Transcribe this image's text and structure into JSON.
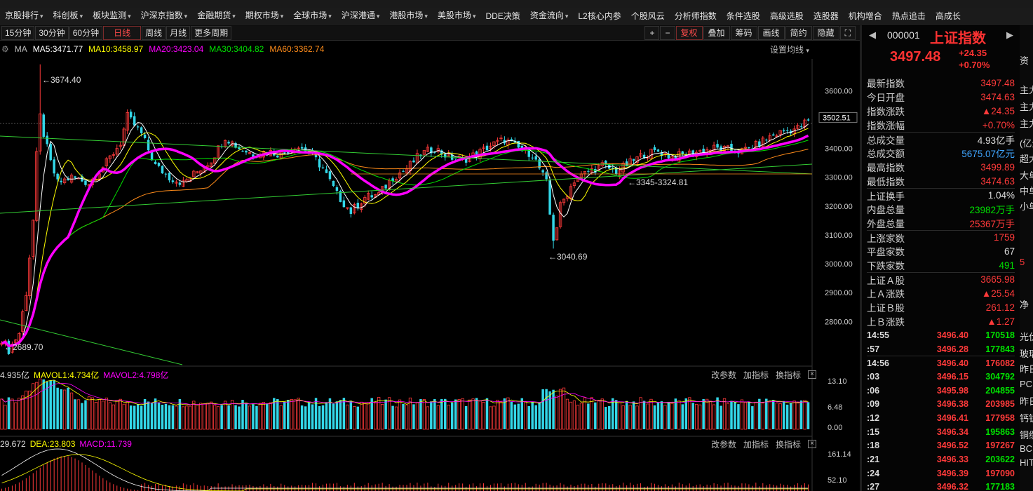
{
  "nav": {
    "items": [
      "京股排行",
      "科创板",
      "板块监测",
      "沪深京指数",
      "金融期货",
      "期权市场",
      "全球市场",
      "沪深港通",
      "港股市场",
      "美股市场",
      "DDE决策",
      "资金流向",
      "L2核心内参",
      "个股风云",
      "分析师指数",
      "条件选股",
      "高级选股",
      "选股器",
      "机构增合",
      "热点追击",
      "高成长"
    ]
  },
  "toolbar": {
    "periods": [
      "15分钟",
      "30分钟",
      "60分钟",
      "日线",
      "周线",
      "月线",
      "更多周期"
    ],
    "active_period": "日线",
    "right_buttons": [
      "复权",
      "叠加",
      "筹码",
      "画线",
      "简约",
      "隐藏"
    ]
  },
  "ma_legend": {
    "label": "MA",
    "ma5": "MA5:3471.77",
    "ma10": "MA10:3458.97",
    "ma20": "MA20:3423.04",
    "ma30": "MA30:3404.82",
    "ma60": "MA60:3362.74",
    "setting": "设置均线"
  },
  "colors": {
    "up": "#ff3a3a",
    "down": "#33d7e8",
    "ma5": "#ffffff",
    "ma10": "#ffff00",
    "ma20": "#ff00ff",
    "ma30": "#00e000",
    "ma60": "#ff8c1a"
  },
  "price_axis": {
    "ticks": [
      "3600.00",
      "3500.00",
      "3400.00",
      "3300.00",
      "3200.00",
      "3100.00",
      "3000.00",
      "2900.00",
      "2800.00"
    ],
    "current": "3502.51"
  },
  "annotations": {
    "high": "3674.40",
    "low_recent": "3040.69",
    "low_start": "2689.70",
    "mid": "3345-3324.81"
  },
  "volume_legend": {
    "vol": "4.935亿",
    "mavol1": "MAVOL1:4.734亿",
    "mavol2": "MAVOL2:4.798亿",
    "axis": [
      "13.10",
      "6.48",
      "0.00"
    ]
  },
  "macd_legend": {
    "dif": "29.672",
    "dea": "DEA:23.803",
    "macd": "MACD:11.739",
    "axis": [
      "161.14",
      "52.10"
    ]
  },
  "sub_tools": [
    "改参数",
    "加指标",
    "换指标"
  ],
  "quote": {
    "code": "000001",
    "name": "上证指数",
    "price": "3497.48",
    "change": "+24.35",
    "pct": "+0.70%",
    "stats": [
      {
        "label": "最新指数",
        "value": "3497.48",
        "cls": ""
      },
      {
        "label": "今日开盘",
        "value": "3474.63",
        "cls": ""
      },
      {
        "label": "指数涨跌",
        "value": "▲24.35",
        "cls": ""
      },
      {
        "label": "指数涨幅",
        "value": "+0.70%",
        "cls": ""
      },
      {
        "label": "总成交量",
        "value": "4.93亿手",
        "cls": "w"
      },
      {
        "label": "总成交额",
        "value": "5675.07亿元",
        "cls": "b"
      },
      {
        "label": "最高指数",
        "value": "3499.89",
        "cls": ""
      },
      {
        "label": "最低指数",
        "value": "3474.63",
        "cls": ""
      },
      {
        "label": "上证换手",
        "value": "1.04%",
        "cls": "w"
      },
      {
        "label": "内盘总量",
        "value": "23982万手",
        "cls": "g"
      },
      {
        "label": "外盘总量",
        "value": "25367万手",
        "cls": ""
      },
      {
        "label": "上涨家数",
        "value": "1759",
        "cls": ""
      },
      {
        "label": "平盘家数",
        "value": "67",
        "cls": "w"
      },
      {
        "label": "下跌家数",
        "value": "491",
        "cls": "g"
      },
      {
        "label": "上证Ａ股",
        "value": "3665.98",
        "cls": ""
      },
      {
        "label": "上Ａ涨跌",
        "value": "▲25.54",
        "cls": ""
      },
      {
        "label": "上证Ｂ股",
        "value": "261.12",
        "cls": ""
      },
      {
        "label": "上Ｂ涨跌",
        "value": "▲1.27",
        "cls": ""
      }
    ],
    "ticks": [
      {
        "t": "14:55",
        "p": "3496.40",
        "v": "170518",
        "c": "g"
      },
      {
        "t": ":57",
        "p": "3496.28",
        "v": "177843",
        "c": "g"
      },
      {
        "t": "14:56",
        "p": "3496.40",
        "v": "176082",
        "c": "r"
      },
      {
        "t": ":03",
        "p": "3496.15",
        "v": "304792",
        "c": "g"
      },
      {
        "t": ":06",
        "p": "3495.98",
        "v": "204855",
        "c": "g"
      },
      {
        "t": ":09",
        "p": "3496.38",
        "v": "203985",
        "c": "r"
      },
      {
        "t": ":12",
        "p": "3496.41",
        "v": "177958",
        "c": "r"
      },
      {
        "t": ":15",
        "p": "3496.34",
        "v": "195863",
        "c": "g"
      },
      {
        "t": ":18",
        "p": "3496.52",
        "v": "197267",
        "c": "r"
      },
      {
        "t": ":21",
        "p": "3496.33",
        "v": "203622",
        "c": "g"
      },
      {
        "t": ":24",
        "p": "3496.39",
        "v": "197090",
        "c": "r"
      },
      {
        "t": ":27",
        "p": "3496.32",
        "v": "177183",
        "c": "g"
      }
    ],
    "side_labels": [
      "资",
      "主力",
      "主力",
      "主力",
      "(亿元",
      "超大",
      "大单",
      "中单",
      "小单",
      "5",
      "净",
      "光伏",
      "玻璃",
      "昨日",
      "PC",
      "昨日",
      "钙钛",
      "铜缆",
      "BC",
      "HIT"
    ]
  },
  "chart_data": {
    "type": "candlestick",
    "period": "日线",
    "ylim": [
      2650,
      3720
    ],
    "price_anchors": [
      [
        0,
        2740
      ],
      [
        2,
        2700
      ],
      [
        5,
        2760
      ],
      [
        7,
        2900
      ],
      [
        9,
        3150
      ],
      [
        11,
        3600
      ],
      [
        12,
        3450
      ],
      [
        14,
        3350
      ],
      [
        16,
        3280
      ],
      [
        20,
        3300
      ],
      [
        25,
        3280
      ],
      [
        30,
        3350
      ],
      [
        34,
        3420
      ],
      [
        36,
        3510
      ],
      [
        40,
        3450
      ],
      [
        44,
        3340
      ],
      [
        48,
        3300
      ],
      [
        52,
        3280
      ],
      [
        56,
        3320
      ],
      [
        60,
        3360
      ],
      [
        64,
        3440
      ],
      [
        68,
        3400
      ],
      [
        72,
        3380
      ],
      [
        76,
        3390
      ],
      [
        80,
        3380
      ],
      [
        84,
        3410
      ],
      [
        88,
        3390
      ],
      [
        92,
        3330
      ],
      [
        96,
        3240
      ],
      [
        100,
        3180
      ],
      [
        104,
        3230
      ],
      [
        108,
        3240
      ],
      [
        112,
        3300
      ],
      [
        116,
        3330
      ],
      [
        120,
        3380
      ],
      [
        124,
        3400
      ],
      [
        128,
        3370
      ],
      [
        132,
        3360
      ],
      [
        136,
        3380
      ],
      [
        140,
        3410
      ],
      [
        144,
        3430
      ],
      [
        148,
        3400
      ],
      [
        152,
        3380
      ],
      [
        156,
        3280
      ],
      [
        158,
        3060
      ],
      [
        160,
        3200
      ],
      [
        164,
        3290
      ],
      [
        168,
        3320
      ],
      [
        172,
        3340
      ],
      [
        176,
        3320
      ],
      [
        180,
        3350
      ],
      [
        184,
        3380
      ],
      [
        188,
        3390
      ],
      [
        192,
        3370
      ],
      [
        196,
        3380
      ],
      [
        200,
        3390
      ],
      [
        204,
        3400
      ],
      [
        208,
        3395
      ],
      [
        212,
        3390
      ],
      [
        216,
        3410
      ],
      [
        220,
        3440
      ],
      [
        224,
        3460
      ],
      [
        228,
        3470
      ],
      [
        231,
        3497
      ]
    ],
    "n_days": 232
  }
}
